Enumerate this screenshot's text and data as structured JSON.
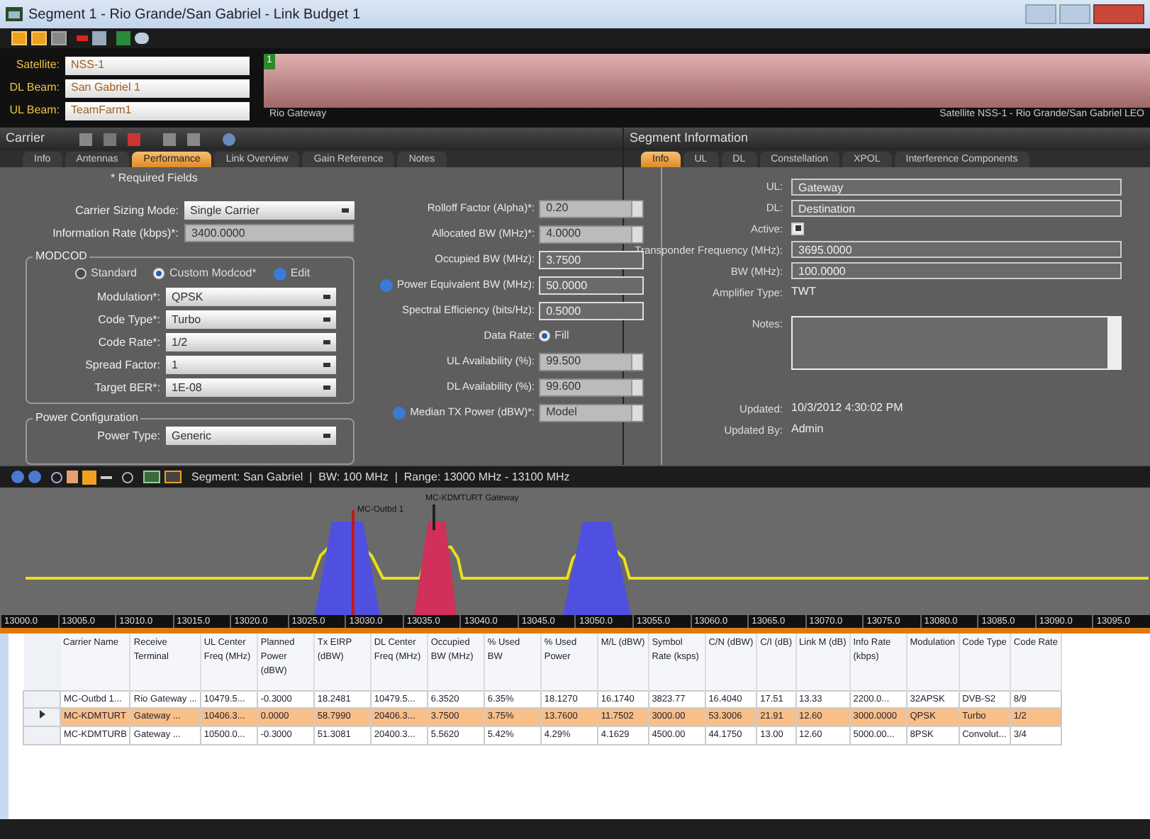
{
  "window": {
    "title": "Segment 1 - Rio Grande/San Gabriel - Link Budget 1"
  },
  "selectors": [
    {
      "label": "Satellite:",
      "value": "NSS-1"
    },
    {
      "label": "DL Beam:",
      "value": "San Gabriel 1"
    },
    {
      "label": "UL Beam:",
      "value": "TeamFarm1"
    }
  ],
  "band_bar": {
    "marker": "1",
    "left_label": "Rio Gateway",
    "right_label": "Satellite NSS-1 - Rio Grande/San Gabriel LEO"
  },
  "carrier_panel": {
    "title": "Carrier",
    "tabs": [
      {
        "label": "Info",
        "selected": false
      },
      {
        "label": "Antennas",
        "selected": false
      },
      {
        "label": "Performance",
        "selected": true
      },
      {
        "label": "Link Overview",
        "selected": false
      },
      {
        "label": "Gain Reference",
        "selected": false
      },
      {
        "label": "Notes",
        "selected": false
      }
    ],
    "required_note": "* Required Fields",
    "left_fields": [
      {
        "kind": "select",
        "label": "Carrier Sizing Mode:",
        "value": "Single Carrier"
      },
      {
        "kind": "readonly",
        "label": "Information Rate (kbps)*:",
        "value": "3400.0000"
      }
    ],
    "modcod": {
      "title": "MODCOD",
      "radios": [
        {
          "label": "Standard",
          "selected": false
        },
        {
          "label": "Custom Modcod*",
          "selected": true
        }
      ],
      "edit_label": "Edit",
      "fields": [
        {
          "kind": "select",
          "label": "Modulation*:",
          "value": "QPSK"
        },
        {
          "kind": "select",
          "label": "Code Type*:",
          "value": "Turbo"
        },
        {
          "kind": "select",
          "label": "Code Rate*:",
          "value": "1/2"
        },
        {
          "kind": "select",
          "label": "Spread Factor:",
          "value": "1"
        },
        {
          "kind": "select",
          "label": "Target BER*:",
          "value": "1E-08"
        }
      ]
    },
    "power_config": {
      "title": "Power Configuration",
      "fields": [
        {
          "kind": "select",
          "label": "Power Type:",
          "value": "Generic"
        }
      ]
    },
    "right_fields": [
      {
        "kind": "spin",
        "label": "Rolloff Factor (Alpha)*:",
        "value": "0.20",
        "info": false
      },
      {
        "kind": "spin",
        "label": "Allocated BW (MHz)*:",
        "value": "4.0000",
        "info": false
      },
      {
        "kind": "text",
        "label": "Occupied BW (MHz):",
        "value": "3.7500",
        "info": false
      },
      {
        "kind": "text",
        "label": "Power Equivalent BW (MHz):",
        "value": "50.0000",
        "info": true
      },
      {
        "kind": "text",
        "label": "Spectral Efficiency (bits/Hz):",
        "value": "0.5000",
        "info": false
      },
      {
        "kind": "radio",
        "label": "Data Rate:",
        "value": "Fill",
        "selected": true,
        "info": false
      },
      {
        "kind": "spin",
        "label": "UL Availability (%):",
        "value": "99.500",
        "info": false
      },
      {
        "kind": "spin",
        "label": "DL Availability (%):",
        "value": "99.600",
        "info": false
      },
      {
        "kind": "spin",
        "label": "Median TX Power (dBW)*:",
        "value": "Model",
        "info": true
      }
    ]
  },
  "segment_panel": {
    "title": "Segment Information",
    "tabs": [
      {
        "label": "Info",
        "selected": true
      },
      {
        "label": "UL",
        "selected": false
      },
      {
        "label": "DL",
        "selected": false
      },
      {
        "label": "Constellation",
        "selected": false
      },
      {
        "label": "XPOL",
        "selected": false
      },
      {
        "label": "Interference Components",
        "selected": false
      }
    ],
    "fields": [
      {
        "kind": "text",
        "label": "UL:",
        "value": "Gateway"
      },
      {
        "kind": "text",
        "label": "DL:",
        "value": "Destination"
      },
      {
        "kind": "check",
        "label": "Active:",
        "checked": true
      },
      {
        "kind": "text",
        "label": "Transponder Frequency (MHz):",
        "value": "3695.0000"
      },
      {
        "kind": "text",
        "label": "BW (MHz):",
        "value": "100.0000"
      },
      {
        "kind": "plain",
        "label": "Amplifier Type:",
        "value": "TWT"
      },
      {
        "kind": "notes",
        "label": "Notes:"
      },
      {
        "kind": "plain",
        "label": "Updated:",
        "value": "10/3/2012 4:30:02 PM"
      },
      {
        "kind": "plain",
        "label": "Updated By:",
        "value": "Admin"
      }
    ]
  },
  "spectrum": {
    "toolbar_text": "Segment: San Gabriel  |  BW: 100 MHz  |  Range: 13000 MHz - 13100 MHz",
    "markers": [
      {
        "label": "MC-Outbd 1",
        "color": "#c0181c"
      },
      {
        "label": "MC-KDMTURT Gateway",
        "color": "#222222"
      }
    ],
    "axis_labels": [
      "13000.0",
      "13005.0",
      "13010.0",
      "13015.0",
      "13020.0",
      "13025.0",
      "13030.0",
      "13035.0",
      "13040.0",
      "13045.0",
      "13050.0",
      "13055.0",
      "13060.0",
      "13065.0",
      "13070.0",
      "13075.0",
      "13080.0",
      "13085.0",
      "13090.0",
      "13095.0"
    ]
  },
  "table": {
    "columns": [
      "Carrier Name",
      "Receive Terminal",
      "UL Center Freq (MHz)",
      "Planned Power (dBW)",
      "Tx EIRP (dBW)",
      "DL Center Freq (MHz)",
      "Occupied BW (MHz)",
      "% Used BW",
      "% Used Power",
      "M/L (dBW)",
      "Symbol Rate (ksps)",
      "C/N (dBW)",
      "C/I (dB)",
      "Link M (dB)",
      "Info Rate (kbps)",
      "Modulation",
      "Code Type",
      "Code Rate"
    ],
    "rows": [
      {
        "selected": false,
        "cells": [
          "MC-Outbd 1...",
          "Rio Gateway ...",
          "10479.5...",
          "-0.3000",
          "18.2481",
          "10479.5...",
          "6.3520",
          "6.35%",
          "18.1270",
          "16.1740",
          "3823.77",
          "16.4040",
          "17.51",
          "13.33",
          "2200.0...",
          "32APSK",
          "DVB-S2",
          "8/9"
        ]
      },
      {
        "selected": true,
        "cells": [
          "MC-KDMTURT",
          "Gateway ...",
          "10406.3...",
          "0.0000",
          "58.7990",
          "20406.3...",
          "3.7500",
          "3.75%",
          "13.7600",
          "11.7502",
          "3000.00",
          "53.3006",
          "21.91",
          "12.60",
          "3000.0000",
          "QPSK",
          "Turbo",
          "1/2"
        ]
      },
      {
        "selected": false,
        "cells": [
          "MC-KDMTURB",
          "Gateway ...",
          "10500.0...",
          "-0.3000",
          "51.3081",
          "20400.3...",
          "5.5620",
          "5.42%",
          "4.29%",
          "4.1629",
          "4500.00",
          "44.1750",
          "13.00",
          "12.60",
          "5000.00...",
          "8PSK",
          "Convolut...",
          "3/4"
        ]
      }
    ]
  }
}
